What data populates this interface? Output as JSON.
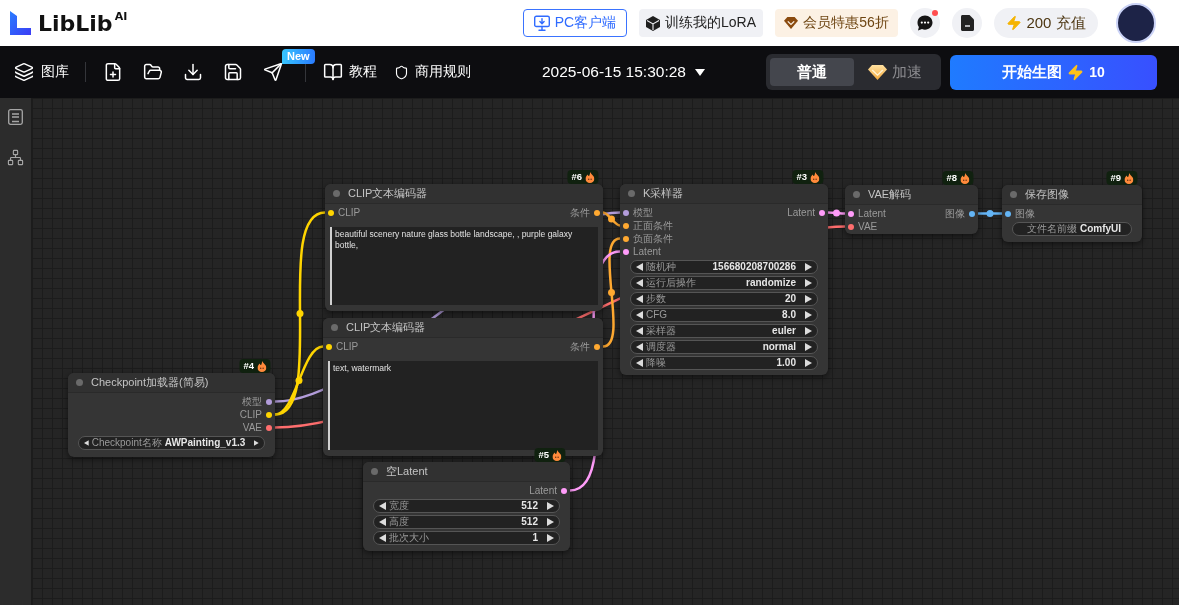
{
  "header": {
    "logo": "LibLib$^{AI}$",
    "buttons": [
      {
        "kind": "client",
        "label": "PC客户端"
      },
      {
        "kind": "lora",
        "label": "训练我的LoRA"
      },
      {
        "kind": "vip",
        "label": "会员特惠56折"
      }
    ],
    "messages": {
      "unread": true
    },
    "recharge": {
      "label": "200 充值"
    }
  },
  "toolbar": {
    "gallery": {
      "label": "图库"
    },
    "tools": [
      {
        "kind": "new-file"
      },
      {
        "kind": "open"
      },
      {
        "kind": "download"
      },
      {
        "kind": "save"
      },
      {
        "kind": "share",
        "badge": "New"
      }
    ],
    "links": [
      {
        "kind": "tutorial",
        "label": "教程"
      },
      {
        "kind": "license",
        "label": "商用规则"
      }
    ],
    "timestamp": "2025-06-15 15:30:28",
    "modes": [
      {
        "kind": "normal",
        "label": "普通",
        "selected": true
      },
      {
        "kind": "fast",
        "label": "加速",
        "selected": false
      }
    ],
    "run_button": {
      "label": "开始生图",
      "cost": "10"
    }
  },
  "nodes": [
    {
      "badge": "#6",
      "title": "CLIP文本编码器",
      "inputs": [
        {
          "name": "CLIP",
          "color": "#ffd500"
        }
      ],
      "outputs": [
        {
          "name": "条件",
          "color": "#ffa931"
        }
      ],
      "text": "beautiful scenery nature glass bottle landscape, , purple galaxy bottle,"
    },
    {
      "badge": "#3",
      "title": "K采样器",
      "inputs": [
        {
          "name": "模型",
          "color": "#b39ddb"
        },
        {
          "name": "正面条件",
          "color": "#ffa931"
        },
        {
          "name": "负面条件",
          "color": "#ffa931"
        },
        {
          "name": "Latent",
          "color": "#ff9cf9"
        }
      ],
      "outputs": [
        {
          "name": "Latent",
          "color": "#ff9cf9"
        }
      ],
      "widgets": [
        {
          "kind": "stepper",
          "label": "随机种",
          "value": "156680208700286"
        },
        {
          "kind": "stepper",
          "label": "运行后操作",
          "value": "randomize"
        },
        {
          "kind": "stepper",
          "label": "步数",
          "value": "20"
        },
        {
          "kind": "stepper",
          "label": "CFG",
          "value": "8.0"
        },
        {
          "kind": "stepper",
          "label": "采样器",
          "value": "euler"
        },
        {
          "kind": "stepper",
          "label": "调度器",
          "value": "normal"
        },
        {
          "kind": "stepper",
          "label": "降噪",
          "value": "1.00"
        }
      ]
    },
    {
      "badge": "#8",
      "title": "VAE解码",
      "inputs": [
        {
          "name": "Latent",
          "color": "#ff9cf9"
        },
        {
          "name": "VAE",
          "color": "#ff6e6e"
        }
      ],
      "outputs": [
        {
          "name": "图像",
          "color": "#64b5f6"
        }
      ]
    },
    {
      "badge": "#9",
      "title": "保存图像",
      "inputs": [
        {
          "name": "图像",
          "color": "#64b5f6"
        }
      ],
      "widgets": [
        {
          "kind": "text",
          "label": "文件名前缀",
          "value": "ComfyUI"
        }
      ]
    },
    {
      "title": "CLIP文本编码器",
      "inputs": [
        {
          "name": "CLIP",
          "color": "#ffd500"
        }
      ],
      "outputs": [
        {
          "name": "条件",
          "color": "#ffa931"
        }
      ],
      "text": "text, watermark"
    },
    {
      "badge": "#4",
      "title": "Checkpoint加载器(简易)",
      "outputs": [
        {
          "name": "模型",
          "color": "#b39ddb"
        },
        {
          "name": "CLIP",
          "color": "#ffd500"
        },
        {
          "name": "VAE",
          "color": "#ff6e6e"
        }
      ],
      "widgets": [
        {
          "kind": "stepper",
          "label": "Checkpoint名称",
          "value": "AWPainting_v1.3"
        }
      ]
    },
    {
      "badge": "#5",
      "title": "空Latent",
      "outputs": [
        {
          "name": "Latent",
          "color": "#ff9cf9"
        }
      ],
      "widgets": [
        {
          "kind": "stepper",
          "label": "宽度",
          "value": "512"
        },
        {
          "kind": "stepper",
          "label": "高度",
          "value": "512"
        },
        {
          "kind": "stepper",
          "label": "批次大小",
          "value": "1"
        }
      ]
    }
  ]
}
